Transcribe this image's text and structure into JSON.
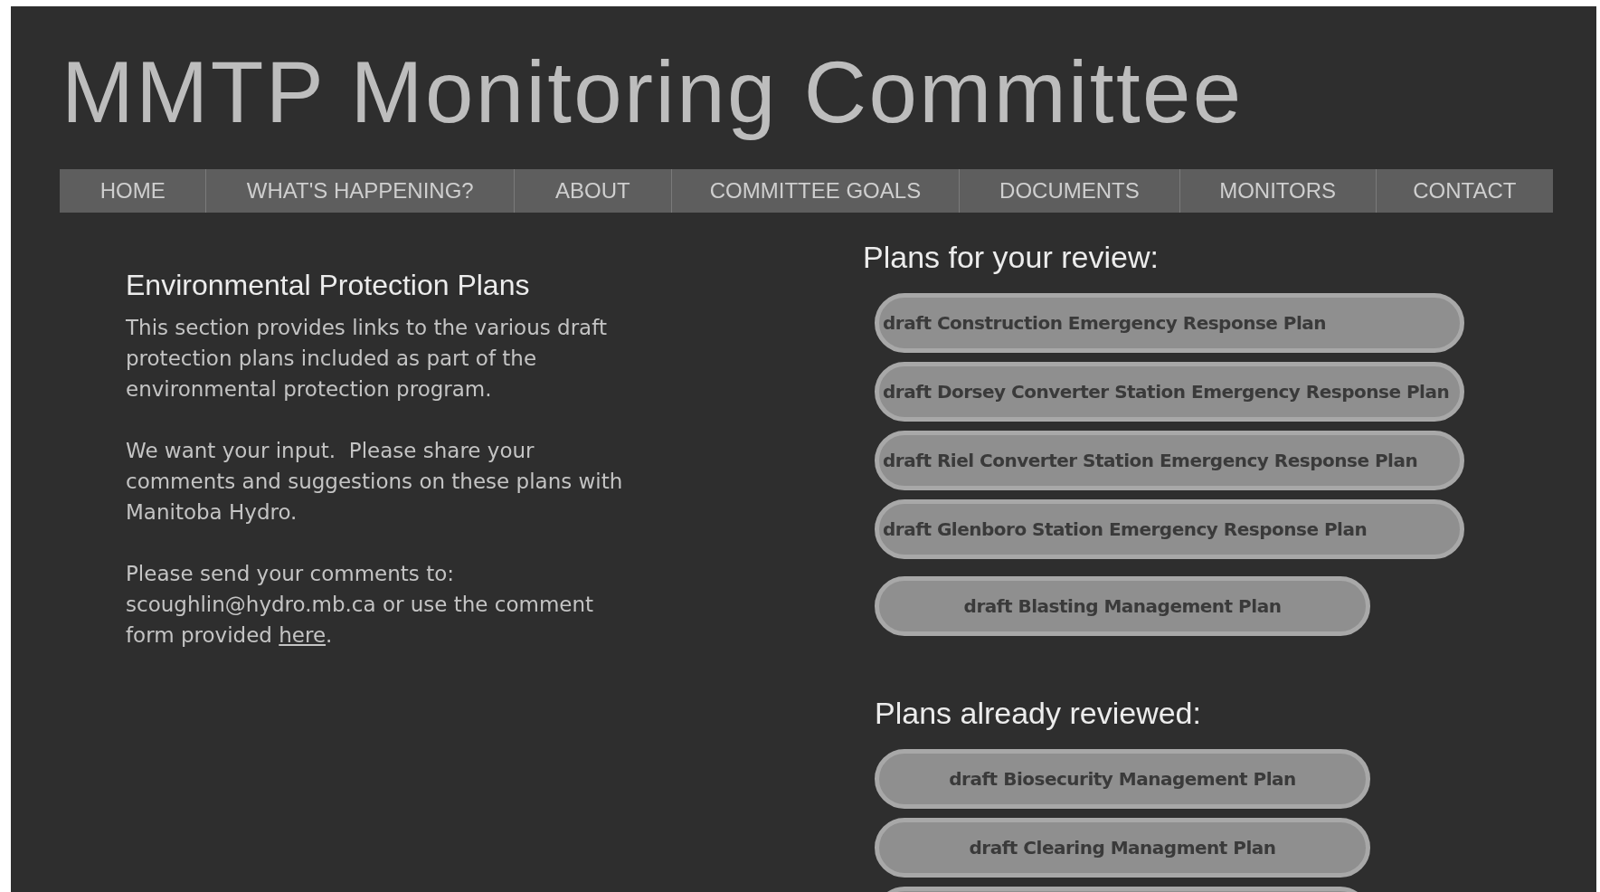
{
  "site_title": "MMTP Monitoring Committee",
  "nav": [
    {
      "label": "HOME"
    },
    {
      "label": "WHAT'S HAPPENING?"
    },
    {
      "label": "ABOUT"
    },
    {
      "label": "COMMITTEE GOALS"
    },
    {
      "label": "DOCUMENTS"
    },
    {
      "label": "MONITORS"
    },
    {
      "label": "CONTACT"
    }
  ],
  "intro": {
    "heading": "Environmental Protection Plans",
    "paragraphs": [
      {
        "text": "This section provides links to the various draft  protection plans included as part of the environmental protection program."
      },
      {
        "text": "We want your input.  Please share your comments and suggestions on these plans with Manitoba Hydro."
      },
      {
        "text": "Please send your comments to: scoughlin@hydro.mb.ca or use the comment form provided ",
        "link": "here",
        "after": "."
      }
    ]
  },
  "review": {
    "heading": "Plans for your review:",
    "plans": [
      {
        "label": "draft Construction Emergency Response Plan",
        "kind": "wide"
      },
      {
        "label": "draft Dorsey Converter Station Emergency Response Plan",
        "kind": "wide"
      },
      {
        "label": "draft Riel Converter Station Emergency Response Plan",
        "kind": "wide"
      },
      {
        "label": "draft Glenboro Station Emergency Response Plan",
        "kind": "wide"
      },
      {
        "label": "draft Blasting Management Plan",
        "kind": "narrow"
      }
    ]
  },
  "reviewed": {
    "heading": "Plans already reviewed:",
    "plans": [
      {
        "label": "draft Biosecurity Management Plan",
        "kind": "narrow"
      },
      {
        "label": "draft Clearing Managment Plan",
        "kind": "narrow"
      },
      {
        "kind": "cut"
      }
    ]
  }
}
